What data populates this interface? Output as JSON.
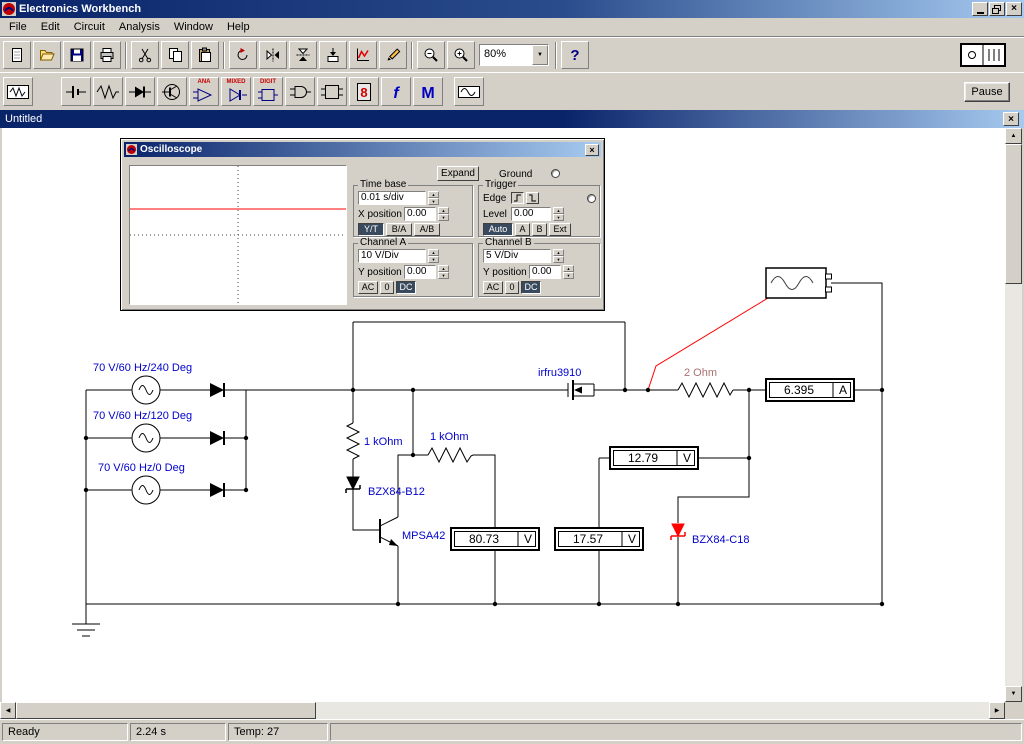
{
  "colors": {
    "titlebar": "#0A246A",
    "titlebar_light": "#A6CAF0",
    "component_label_blue": "#0000CC",
    "trace_red": "#FF0000",
    "selected_component_red": "#FF0000",
    "chrome_gray": "#D4D0C8"
  },
  "icons": {
    "close": "×",
    "arrow_up": "▲",
    "arrow_down": "▼",
    "arrow_left": "◀",
    "arrow_right": "▶",
    "help": "?"
  },
  "titlebar": {
    "title": "Electronics Workbench"
  },
  "menu": {
    "items": [
      "File",
      "Edit",
      "Circuit",
      "Analysis",
      "Window",
      "Help"
    ]
  },
  "toolbar": {
    "zoom_value": "80%"
  },
  "parts": {
    "ana": "ANA",
    "mixed": "MIXED",
    "digit": "DIGIT",
    "indicators_glyph": "8",
    "controls_glyph": "f",
    "misc_glyph": "M",
    "pause": "Pause"
  },
  "doc": {
    "title": "Untitled"
  },
  "osc": {
    "title": "Oscilloscope",
    "expand": "Expand",
    "ground": "Ground",
    "time_base": {
      "title": "Time base",
      "scale": "0.01 s/div",
      "x_position_label": "X position",
      "x_position": "0.00",
      "mode_yt": "Y/T",
      "mode_ba": "B/A",
      "mode_ab": "A/B"
    },
    "trigger": {
      "title": "Trigger",
      "edge_label": "Edge",
      "level_label": "Level",
      "level": "0.00",
      "auto": "Auto",
      "a": "A",
      "b": "B",
      "ext": "Ext"
    },
    "channel_a": {
      "title": "Channel A",
      "scale": "10 V/Div",
      "y_position_label": "Y position",
      "y_position": "0.00",
      "ac": "AC",
      "zero": "0",
      "dc": "DC"
    },
    "channel_b": {
      "title": "Channel B",
      "scale": "5 V/Div",
      "y_position_label": "Y position",
      "y_position": "0.00",
      "ac": "AC",
      "zero": "0",
      "dc": "DC"
    }
  },
  "circuit": {
    "source_labels": [
      "70 V/60 Hz/240 Deg",
      "70 V/60 Hz/120 Deg",
      "70 V/60 Hz/0 Deg"
    ],
    "r_series_label": "1 kOhm",
    "r_gate_label": "1 kOhm",
    "r_load_label": "2 Ohm",
    "mosfet_label": "irfru3910",
    "zener_b12_label": "BZX84-B12",
    "transistor_label": "MPSA42",
    "zener_c18_label": "BZX84-C18",
    "ammeter": {
      "value": "6.395",
      "unit": "A"
    },
    "voltmeter_out": {
      "value": "12.79",
      "unit": "V"
    },
    "voltmeter_in": {
      "value": "80.73",
      "unit": "V"
    },
    "voltmeter_z": {
      "value": "17.57",
      "unit": "V"
    }
  },
  "status": {
    "ready": "Ready",
    "sim_time": "2.24 s",
    "temp": "Temp:  27"
  }
}
